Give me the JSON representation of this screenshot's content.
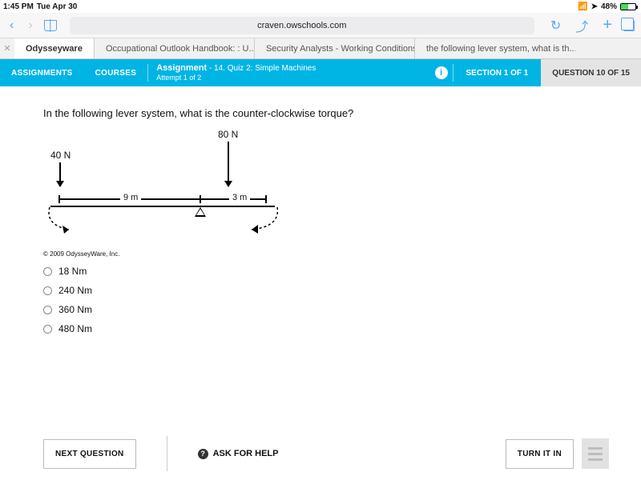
{
  "status": {
    "time": "1:45 PM",
    "date": "Tue Apr 30",
    "battery_pct": "48%"
  },
  "browser": {
    "url": "craven.owschools.com",
    "tabs": [
      "Odysseyware",
      "Occupational Outlook Handbook: : U....",
      "Security Analysts - Working Conditions",
      "the following lever system, what is th..."
    ]
  },
  "appbar": {
    "assignments": "ASSIGNMENTS",
    "courses": "COURSES",
    "assignment_label": "Assignment",
    "assignment_title": "- 14. Quiz 2: Simple Machines",
    "attempt": "Attempt 1 of 2",
    "section": "SECTION 1 OF 1",
    "qcount": "QUESTION 10 OF 15"
  },
  "question": {
    "prompt": "In the following lever system, what is the counter-clockwise torque?",
    "force_left": "40 N",
    "force_right": "80 N",
    "dist_left": "9 m",
    "dist_right": "3 m",
    "copyright": "© 2009 OdysseyWare, Inc.",
    "options": [
      "18 Nm",
      "240 Nm",
      "360 Nm",
      "480 Nm"
    ]
  },
  "footer": {
    "next": "NEXT QUESTION",
    "ask": "ASK FOR HELP",
    "turn_in": "TURN IT IN"
  }
}
